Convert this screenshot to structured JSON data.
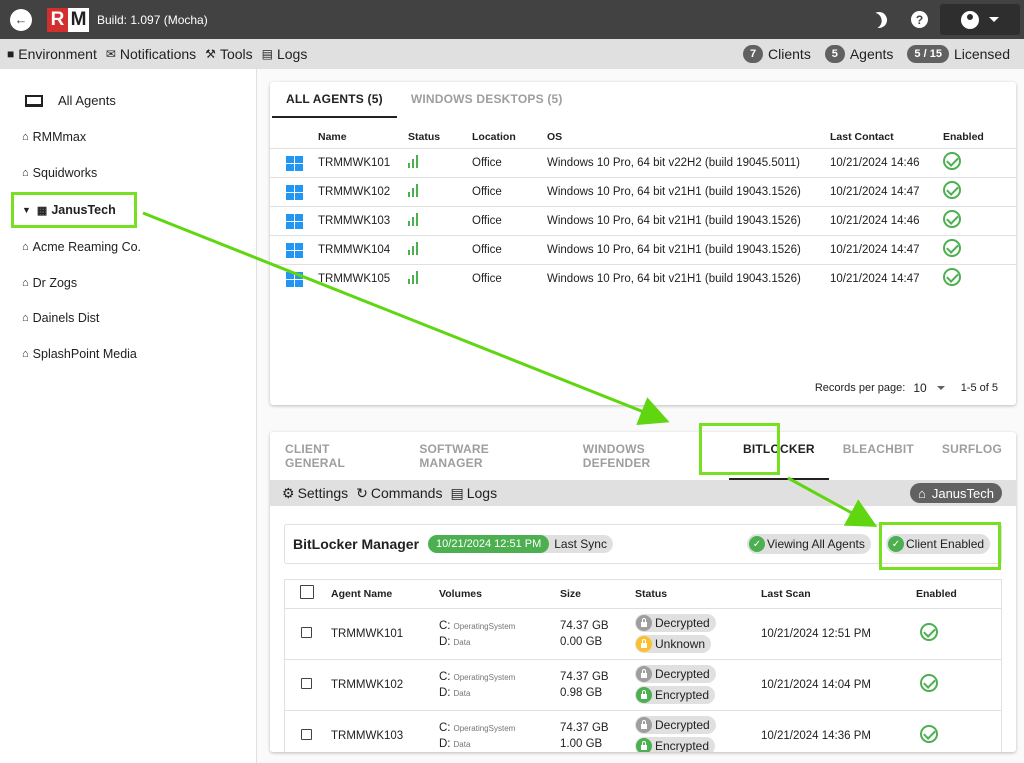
{
  "topbar": {
    "logo_r": "R",
    "logo_m": "M",
    "build": "Build: 1.097 (Mocha)",
    "help_label": "?"
  },
  "menubar": {
    "items": [
      "Environment",
      "Notifications",
      "Tools",
      "Logs"
    ],
    "clients_count": "7",
    "clients_label": "Clients",
    "agents_count": "5",
    "agents_label": "Agents",
    "licensed_count": "5 / 15",
    "licensed_label": "Licensed"
  },
  "sidebar": {
    "all_agents": "All Agents",
    "clients": [
      "RMMmax",
      "Squidworks",
      "JanusTech",
      "Acme Reaming Co.",
      "Dr Zogs",
      "Dainels Dist",
      "SplashPoint Media"
    ]
  },
  "agents_card": {
    "tabs": [
      "ALL AGENTS (5)",
      "WINDOWS DESKTOPS (5)"
    ],
    "columns": [
      "Name",
      "Status",
      "Location",
      "OS",
      "Last Contact",
      "Enabled"
    ],
    "rows": [
      {
        "name": "TRMMWK101",
        "location": "Office",
        "os": "Windows 10 Pro, 64 bit v22H2 (build 19045.5011)",
        "last_contact": "10/21/2024 14:46"
      },
      {
        "name": "TRMMWK102",
        "location": "Office",
        "os": "Windows 10 Pro, 64 bit v21H1 (build 19043.1526)",
        "last_contact": "10/21/2024 14:47"
      },
      {
        "name": "TRMMWK103",
        "location": "Office",
        "os": "Windows 10 Pro, 64 bit v21H1 (build 19043.1526)",
        "last_contact": "10/21/2024 14:46"
      },
      {
        "name": "TRMMWK104",
        "location": "Office",
        "os": "Windows 10 Pro, 64 bit v21H1 (build 19043.1526)",
        "last_contact": "10/21/2024 14:47"
      },
      {
        "name": "TRMMWK105",
        "location": "Office",
        "os": "Windows 10 Pro, 64 bit v21H1 (build 19043.1526)",
        "last_contact": "10/21/2024 14:47"
      }
    ],
    "records_label": "Records per page:",
    "records_value": "10",
    "range": "1-5 of 5"
  },
  "bottom_panel": {
    "tabs": [
      "CLIENT GENERAL",
      "SOFTWARE MANAGER",
      "WINDOWS DEFENDER",
      "BITLOCKER",
      "BLEACHBIT",
      "SURFLOG"
    ],
    "subnav": [
      "Settings",
      "Commands",
      "Logs"
    ],
    "client_chip": "JanusTech",
    "title": "BitLocker Manager",
    "sync_time": "10/21/2024 12:51 PM",
    "sync_label": "Last Sync",
    "viewing_label": "Viewing All Agents",
    "client_enabled_label": "Client Enabled",
    "columns": [
      "Agent Name",
      "Volumes",
      "Size",
      "Status",
      "Last Scan",
      "Enabled"
    ],
    "rows": [
      {
        "name": "TRMMWK101",
        "vol1": "C:",
        "vol1_type": "OperatingSystem",
        "vol2": "D:",
        "vol2_type": "Data",
        "size1": "74.37 GB",
        "size2": "0.00 GB",
        "status1": "Decrypted",
        "status2": "Unknown",
        "last_scan": "10/21/2024 12:51 PM"
      },
      {
        "name": "TRMMWK102",
        "vol1": "C:",
        "vol1_type": "OperatingSystem",
        "vol2": "D:",
        "vol2_type": "Data",
        "size1": "74.37 GB",
        "size2": "0.98 GB",
        "status1": "Decrypted",
        "status2": "Encrypted",
        "last_scan": "10/21/2024 14:04 PM"
      },
      {
        "name": "TRMMWK103",
        "vol1": "C:",
        "vol1_type": "OperatingSystem",
        "vol2": "D:",
        "vol2_type": "Data",
        "size1": "74.37 GB",
        "size2": "1.00 GB",
        "status1": "Decrypted",
        "status2": "Encrypted",
        "last_scan": "10/21/2024 14:36 PM"
      }
    ]
  },
  "colors": {
    "accent_green": "#4caf50",
    "highlight": "#76e021",
    "topbar": "#424242",
    "logo_red": "#d32f2f",
    "windows_blue": "#2196f3"
  }
}
